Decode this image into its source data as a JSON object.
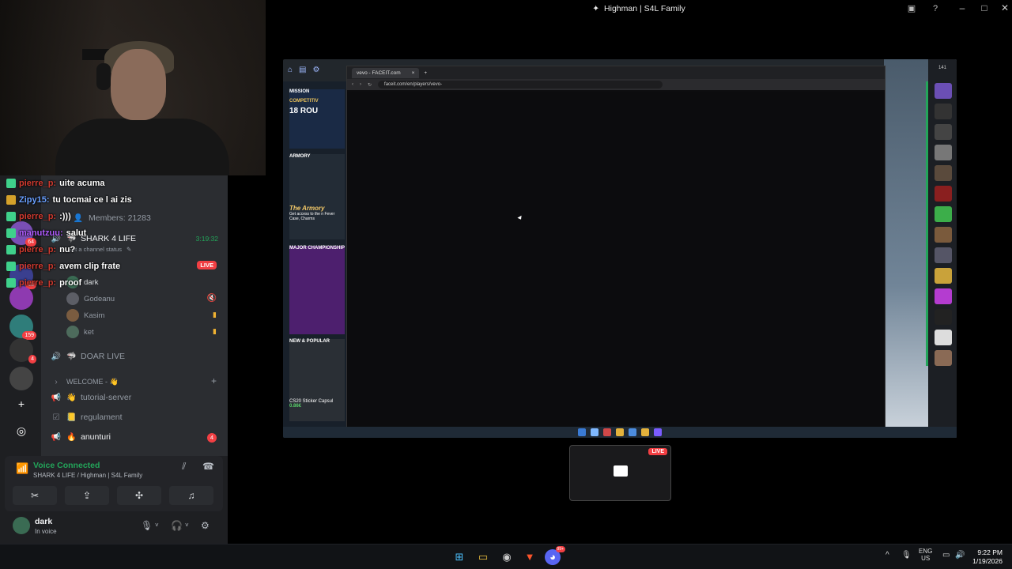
{
  "window": {
    "title": "Highman | S4L Family"
  },
  "chat": {
    "lines": [
      {
        "nick": "pierre_p:",
        "msg": "uite acuma"
      },
      {
        "nick": "Zipy15:",
        "msg": "tu tocmai ce l ai zis"
      },
      {
        "nick": "pierre_p:",
        "msg": ":)))"
      },
      {
        "nick": "manutzuu:",
        "msg": "salut"
      },
      {
        "nick": "pierre_p:",
        "msg": "nu?"
      },
      {
        "nick": "pierre_p:",
        "msg": "avem clip frate"
      },
      {
        "nick": "pierre_p:",
        "msg": "proof"
      }
    ]
  },
  "server_list": {
    "badges": [
      "64",
      "18",
      "159",
      "4"
    ]
  },
  "channels": {
    "members_label": "Members: 21283",
    "voice_channel": "SHARK 4 LIFE",
    "voice_time": "3:19:32",
    "channel_status_placeholder": "Set a channel status",
    "live_label": "LIVE",
    "voice_users": [
      "dark",
      "Godeanu",
      "Kasim",
      "ket"
    ],
    "doar_live": "DOAR LIVE",
    "category": "WELCOME - 👋",
    "text_channels": [
      {
        "name": "tutorial-server",
        "emoji": "👋"
      },
      {
        "name": "regulament",
        "emoji": "📒"
      },
      {
        "name": "anunturi",
        "emoji": "🔥",
        "badge": "4"
      }
    ]
  },
  "voice": {
    "status": "Voice Connected",
    "location": "SHARK 4 LIFE / Highman | S4L Family"
  },
  "user": {
    "name": "dark",
    "status": "In voice"
  },
  "stream": {
    "browser_tab": "vevo - FACEIT.com",
    "url": "faceit.com/en/players/vevo-",
    "cards": {
      "mission": "MISSION",
      "competitive": "COMPETITIV",
      "rounds": "18 ROU",
      "armory": "ARMORY",
      "armory_title": "The Armory",
      "armory_desc": "Get access to the n Fever Case, Charms",
      "major": "MAJOR CHAMPIONSHIP",
      "new_popular": "NEW & POPULAR",
      "sticker": "CS20 Sticker Capsul",
      "sticker_price": "0.86€"
    },
    "thumb_live": "LIVE",
    "right_count": "141"
  },
  "taskbar": {
    "lang_top": "ENG",
    "lang_bottom": "US",
    "time": "9:22 PM",
    "date": "1/19/2026",
    "discord_badge": "99+"
  },
  "colors": {
    "accent": "#5865f2",
    "voice_green": "#23a55a",
    "live_red": "#f23f43",
    "chat_nick": "#d03a2f"
  }
}
